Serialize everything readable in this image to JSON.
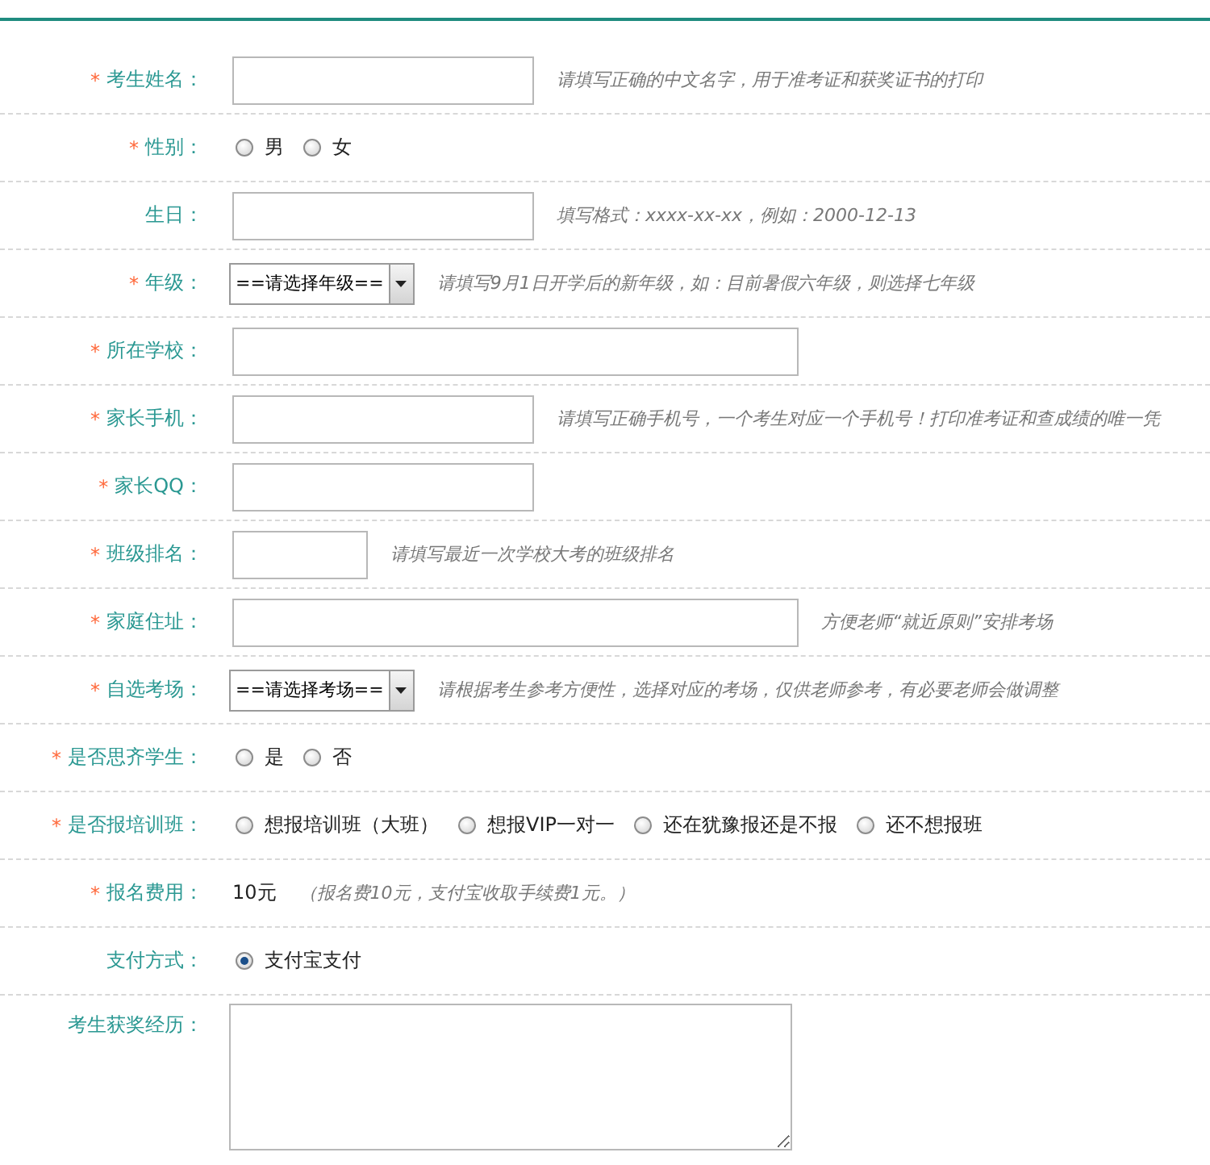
{
  "form": {
    "rows": [
      {
        "kind": "text",
        "label": "考生姓名：",
        "mark": "*",
        "hint": "请填写正确的中文名字，用于准考证和获奖证书的打印"
      },
      {
        "kind": "radio",
        "label": "性别：",
        "mark": "*",
        "options": [
          {
            "label": "男",
            "selected": false
          },
          {
            "label": "女",
            "selected": false
          }
        ]
      },
      {
        "kind": "text",
        "label": "生日：",
        "hint": "填写格式：xxxx-xx-xx，例如：2000-12-13"
      },
      {
        "kind": "select",
        "label": "年级：",
        "mark": "*",
        "value": "==请选择年级==",
        "hint": "请填写9月1日开学后的新年级，如：目前暑假六年级，则选择七年级"
      },
      {
        "kind": "widetext",
        "label": "所在学校：",
        "mark": "*"
      },
      {
        "kind": "text",
        "label": "家长手机：",
        "mark": "*",
        "hint": "请填写正确手机号，一个考生对应一个手机号！打印准考证和查成绩的唯一凭"
      },
      {
        "kind": "text",
        "label": "家长QQ：",
        "mark": "*"
      },
      {
        "kind": "shorttext",
        "label": "班级排名：",
        "mark": "*",
        "hint": "请填写最近一次学校大考的班级排名"
      },
      {
        "kind": "widetext",
        "label": "家庭住址：",
        "mark": "*",
        "hint": "方便老师“就近原则”安排考场"
      },
      {
        "kind": "select",
        "label": "自选考场：",
        "mark": "*",
        "value": "==请选择考场==",
        "hint": "请根据考生参考方便性，选择对应的考场，仅供老师参考，有必要老师会做调整"
      },
      {
        "kind": "radio",
        "label": "是否思齐学生：",
        "mark": "*",
        "options": [
          {
            "label": "是",
            "selected": false
          },
          {
            "label": "否",
            "selected": false
          }
        ]
      },
      {
        "kind": "radio",
        "label": "是否报培训班：",
        "mark": "*",
        "options": [
          {
            "label": "想报培训班（大班）",
            "selected": false
          },
          {
            "label": "想报VIP一对一",
            "selected": false
          },
          {
            "label": "还在犹豫报还是不报",
            "selected": false
          },
          {
            "label": "还不想报班",
            "selected": false
          }
        ]
      },
      {
        "kind": "static",
        "label": "报名费用：",
        "mark": "*",
        "value": "10元",
        "hint": "（报名费10元，支付宝收取手续费1元。）"
      },
      {
        "kind": "radio",
        "label": "支付方式：",
        "options": [
          {
            "label": "支付宝支付",
            "selected": true
          }
        ]
      },
      {
        "kind": "textarea",
        "label": "考生获奖经历："
      }
    ]
  }
}
